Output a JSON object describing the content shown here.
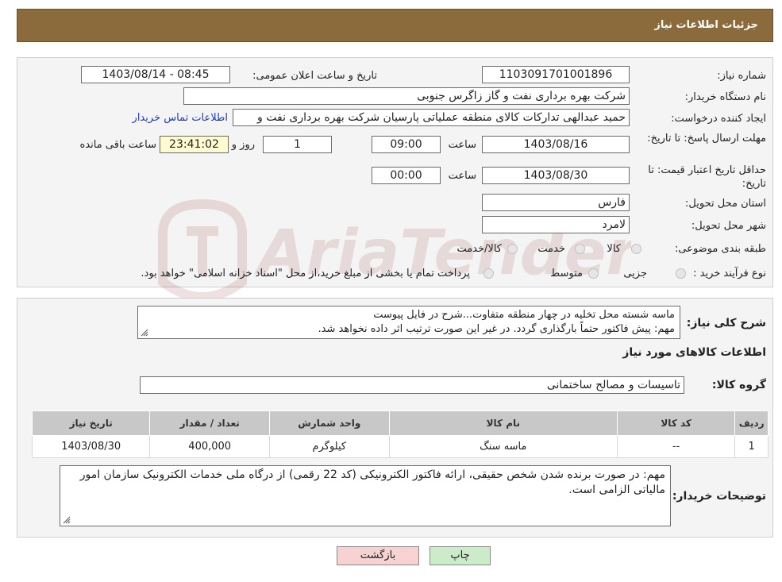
{
  "header": {
    "title": "جزئیات اطلاعات نیاز"
  },
  "fields": {
    "need_number_label": "شماره نیاز:",
    "need_number": "1103091701001896",
    "announce_label": "تاریخ و ساعت اعلان عمومی:",
    "announce_value": "1403/08/14 - 08:45",
    "buyer_org_label": "نام دستگاه خریدار:",
    "buyer_org": "شرکت بهره برداری نفت و گاز زاگرس جنوبی",
    "creator_label": "ایجاد کننده درخواست:",
    "creator": "حمید عبدالهی تدارکات کالای منطقه عملیاتی پارسیان شرکت بهره برداری نفت و",
    "contact_link": "اطلاعات تماس خریدار",
    "deadline_label": "مهلت ارسال پاسخ: تا تاریخ:",
    "deadline_date": "1403/08/16",
    "time_label": "ساعت",
    "deadline_time": "09:00",
    "days_value": "1",
    "days_label": "روز و",
    "remaining_time": "23:41:02",
    "remaining_label": "ساعت باقی مانده",
    "validity_label": "حداقل تاریخ اعتبار قیمت: تا تاریخ:",
    "validity_date": "1403/08/30",
    "validity_time": "00:00",
    "province_label": "استان محل تحویل:",
    "province": "فارس",
    "city_label": "شهر محل تحویل:",
    "city": "لامرد",
    "category_label": "طبقه بندی موضوعی:",
    "category_options": [
      "کالا",
      "خدمت",
      "کالا/خدمت"
    ],
    "purchase_type_label": "نوع فرآیند خرید :",
    "purchase_options": [
      "جزیی",
      "متوسط"
    ],
    "purchase_note": "پرداخت تمام یا بخشی از مبلغ خرید،از محل \"اسناد خزانه اسلامی\" خواهد بود."
  },
  "description": {
    "label": "شرح کلی نیاز:",
    "line1": "ماسه شسته محل تخلیه در چهار منطقه متفاوت...شرح در فایل پیوست",
    "line2": "مهم: پیش فاکتور حتماً بارگذاری گردد. در غیر این صورت ترتیب اثر داده نخواهد شد."
  },
  "goods_section": {
    "title": "اطلاعات کالاهای مورد نیاز",
    "group_label": "گروه کالا:",
    "group_value": "تاسیسات و مصالح ساختمانی"
  },
  "table": {
    "headers": [
      "ردیف",
      "کد کالا",
      "نام کالا",
      "واحد شمارش",
      "تعداد / مقدار",
      "تاریخ نیاز"
    ],
    "rows": [
      [
        "1",
        "--",
        "ماسه سنگ",
        "کیلوگرم",
        "400,000",
        "1403/08/30"
      ]
    ]
  },
  "buyer_notes": {
    "label": "توضیحات خریدار:",
    "text": "مهم: در صورت برنده شدن شخص حقیقی، ارائه فاکتور الکترونیکی (کد 22 رقمی) از درگاه ملی خدمات الکترونیک سازمان امور مالیاتی الزامی است."
  },
  "buttons": {
    "print": "چاپ",
    "back": "بازگشت"
  },
  "watermark": {
    "text": "AriaTender.neT"
  },
  "colors": {
    "header_bg": "#8b6b3b",
    "link": "#1a3cc7",
    "back_btn": "#f7d2d2",
    "print_btn": "#ccebc9",
    "table_header": "#c8c8c8"
  }
}
